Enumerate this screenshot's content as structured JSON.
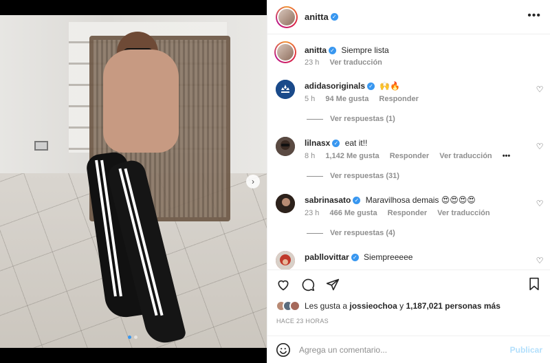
{
  "post": {
    "author": "anitta",
    "verified": true
  },
  "header": {
    "username": "anitta",
    "more_icon": "more-horizontal-icon"
  },
  "caption": {
    "username": "anitta",
    "text": "Siempre lista",
    "time": "23 h",
    "translate": "Ver traducción"
  },
  "comments": [
    {
      "username": "adidasoriginals",
      "text": "🙌🔥",
      "time": "5 h",
      "likes": "94 Me gusta",
      "reply": "Responder",
      "translate": "",
      "replies": "Ver respuestas (1)",
      "avatar_color": "#1a4a8a"
    },
    {
      "username": "lilnasx",
      "text": "eat it!!",
      "time": "8 h",
      "likes": "1,142 Me gusta",
      "reply": "Responder",
      "translate": "Ver traducción",
      "replies": "Ver respuestas (31)",
      "avatar_color": "#3a3a3a"
    },
    {
      "username": "sabrinasato",
      "text": "Maravilhosa demais 😍😍😍😍",
      "time": "23 h",
      "likes": "466 Me gusta",
      "reply": "Responder",
      "translate": "Ver traducción",
      "replies": "Ver respuestas (4)",
      "avatar_color": "#4a3528"
    },
    {
      "username": "pabllovittar",
      "text": "Siempreeeee",
      "avatar_color": "#c0392b"
    }
  ],
  "actions": {
    "like_icon": "heart-icon",
    "comment_icon": "comment-icon",
    "share_icon": "send-icon",
    "save_icon": "bookmark-icon"
  },
  "likes_summary": {
    "prefix": "Les gusta a",
    "user": "jossieochoa",
    "middle": "y",
    "others": "1,187,021 personas más"
  },
  "posted": "HACE 23 HORAS",
  "add_comment": {
    "placeholder": "Agrega un comentario...",
    "publish": "Publicar"
  },
  "colors": {
    "accent": "#3897f0",
    "publish_disabled": "#b2dffc",
    "muted": "#8e8e8e"
  }
}
